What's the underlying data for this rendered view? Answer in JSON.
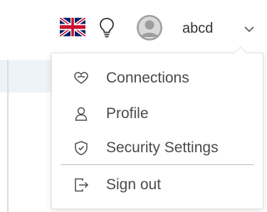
{
  "header": {
    "language_icon": "uk-flag-icon",
    "theme_icon": "lightbulb-icon",
    "avatar_icon": "user-avatar-icon",
    "username": "abcd",
    "dropdown_icon": "chevron-down-icon"
  },
  "menu": {
    "items": [
      {
        "label": "Connections",
        "icon": "connections-icon"
      },
      {
        "label": "Profile",
        "icon": "user-icon"
      },
      {
        "label": "Security Settings",
        "icon": "shield-check-icon"
      },
      {
        "label": "Sign out",
        "icon": "sign-out-icon"
      }
    ]
  },
  "colors": {
    "text": "#4a4a4a",
    "border": "#e3e3e3",
    "divider": "#bdbdbd",
    "flag_blue": "#012169",
    "flag_red": "#C8102E"
  }
}
